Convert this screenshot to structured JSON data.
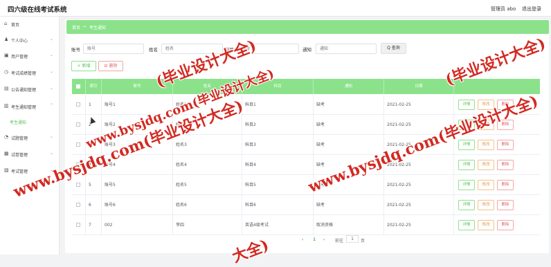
{
  "header": {
    "title": "四六级在线考试系统",
    "admin": "管理员 abo",
    "logout": "退出登录"
  },
  "sidebar": {
    "items": [
      {
        "icon": "home-icon",
        "glyph": "⌂",
        "label": "首页",
        "chev": false
      },
      {
        "icon": "user-icon",
        "glyph": "♟",
        "label": "个人中心",
        "chev": true
      },
      {
        "icon": "users-icon",
        "glyph": "▣",
        "label": "用户管理",
        "chev": true
      },
      {
        "icon": "grade-icon",
        "glyph": "◷",
        "label": "考试成绩管理",
        "chev": true
      },
      {
        "icon": "notice-icon",
        "glyph": "▤",
        "label": "公告通知管理",
        "chev": true
      },
      {
        "icon": "exam-notice-icon",
        "glyph": "▥",
        "label": "考生通知管理",
        "chev": true
      },
      {
        "icon": "paper-icon",
        "glyph": "◔",
        "label": "试题管理",
        "chev": true
      },
      {
        "icon": "test-icon",
        "glyph": "▦",
        "label": "试卷管理",
        "chev": true
      },
      {
        "icon": "exam-icon",
        "glyph": "▧",
        "label": "考试管理",
        "chev": true
      }
    ],
    "sub": "考生通知"
  },
  "breadcrumb": {
    "home": "首页",
    "sep": "→",
    "current": "考生通知"
  },
  "filters": {
    "account": {
      "label": "账号",
      "placeholder": "账号"
    },
    "name": {
      "label": "姓名",
      "placeholder": "姓名"
    },
    "subject": {
      "label": "科目",
      "placeholder": "科目"
    },
    "notice": {
      "label": "通知",
      "placeholder": "通知"
    },
    "query": "Q 查询"
  },
  "actions": {
    "add": "+ 新增",
    "del": "⊟ 删除"
  },
  "table": {
    "headers": [
      "索引",
      "账号",
      "姓名",
      "科目",
      "通知",
      "日期"
    ],
    "rows": [
      {
        "idx": "1",
        "account": "账号1",
        "name": "姓名1",
        "subject": "科目1",
        "notice": "缺考",
        "date": "2021-02-25"
      },
      {
        "idx": "2",
        "account": "账号2",
        "name": "姓名2",
        "subject": "科目2",
        "notice": "缺考",
        "date": "2021-02-25"
      },
      {
        "idx": "3",
        "account": "账号3",
        "name": "姓名3",
        "subject": "科目3",
        "notice": "缺考",
        "date": "2021-02-25"
      },
      {
        "idx": "4",
        "account": "账号4",
        "name": "姓名4",
        "subject": "科目4",
        "notice": "缺考",
        "date": "2021-02-25"
      },
      {
        "idx": "5",
        "account": "账号5",
        "name": "姓名5",
        "subject": "科目5",
        "notice": "缺考",
        "date": "2021-02-25"
      },
      {
        "idx": "6",
        "account": "账号6",
        "name": "姓名6",
        "subject": "科目6",
        "notice": "缺考",
        "date": "2021-02-25"
      },
      {
        "idx": "7",
        "account": "002",
        "name": "李四",
        "subject": "英语4级考试",
        "notice": "取消资格",
        "date": "2021-02-25"
      }
    ],
    "row_buttons": {
      "detail": "详情",
      "edit": "修改",
      "delete": "删除"
    }
  },
  "pagination": {
    "prev": "‹",
    "page": "1",
    "next": "›",
    "goto": "前往",
    "page_input": "1",
    "unit": "页"
  },
  "watermarks": [
    "www.bysjdq.com(毕业设计大全)",
    "www.bysjdq.com(毕业设计大全)",
    "(毕业设计大全)",
    "www.bysjdq.com(毕业设计大全)",
    "(毕业设计大全)",
    "大全)"
  ]
}
